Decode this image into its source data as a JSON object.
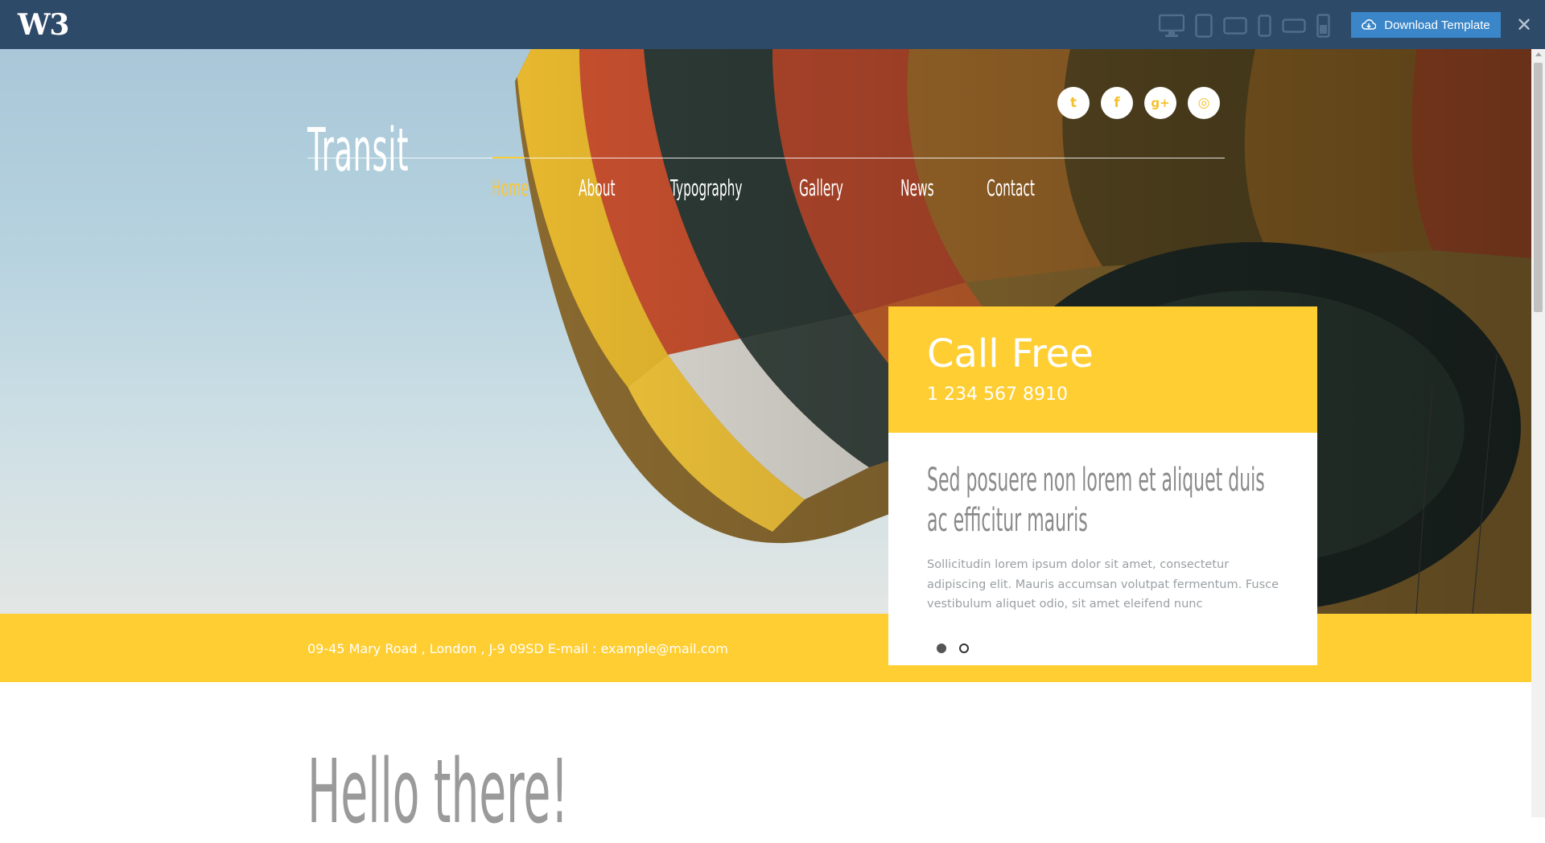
{
  "topbar": {
    "logo": "W3",
    "download_label": "Download Template",
    "close_symbol": "✕",
    "devices": [
      "desktop-icon",
      "tablet-portrait-icon",
      "tablet-landscape-icon",
      "phone-portrait-icon",
      "phone-landscape-icon",
      "small-phone-icon"
    ]
  },
  "site": {
    "brand": "Transit",
    "social": [
      {
        "name": "twitter-icon",
        "glyph": "t"
      },
      {
        "name": "facebook-icon",
        "glyph": "f"
      },
      {
        "name": "google-plus-icon",
        "glyph": "g+"
      },
      {
        "name": "dribbble-icon",
        "glyph": "◎"
      }
    ],
    "nav": [
      "Home",
      "About",
      "Typography",
      "Gallery",
      "News",
      "Contact"
    ],
    "active_nav": "Home",
    "address": "09-45 Mary Road , London , J-9 09SD E-mail : example@mail.com"
  },
  "card": {
    "title": "Call Free",
    "phone": "1 234 567 8910",
    "heading": "Sed posuere non lorem et aliquet duis ac efficitur mauris",
    "text": "Sollicitudin lorem ipsum dolor sit amet, consectetur adipiscing elit. Mauris accumsan volutpat fermentum. Fusce vestibulum aliquet odio, sit amet eleifend nunc",
    "slides": 2,
    "active_slide": 1
  },
  "content": {
    "hello": "Hello there!"
  },
  "colors": {
    "topbar": "#2e4a69",
    "accent_yellow": "#ffce33",
    "download_button": "#3a86c8"
  }
}
